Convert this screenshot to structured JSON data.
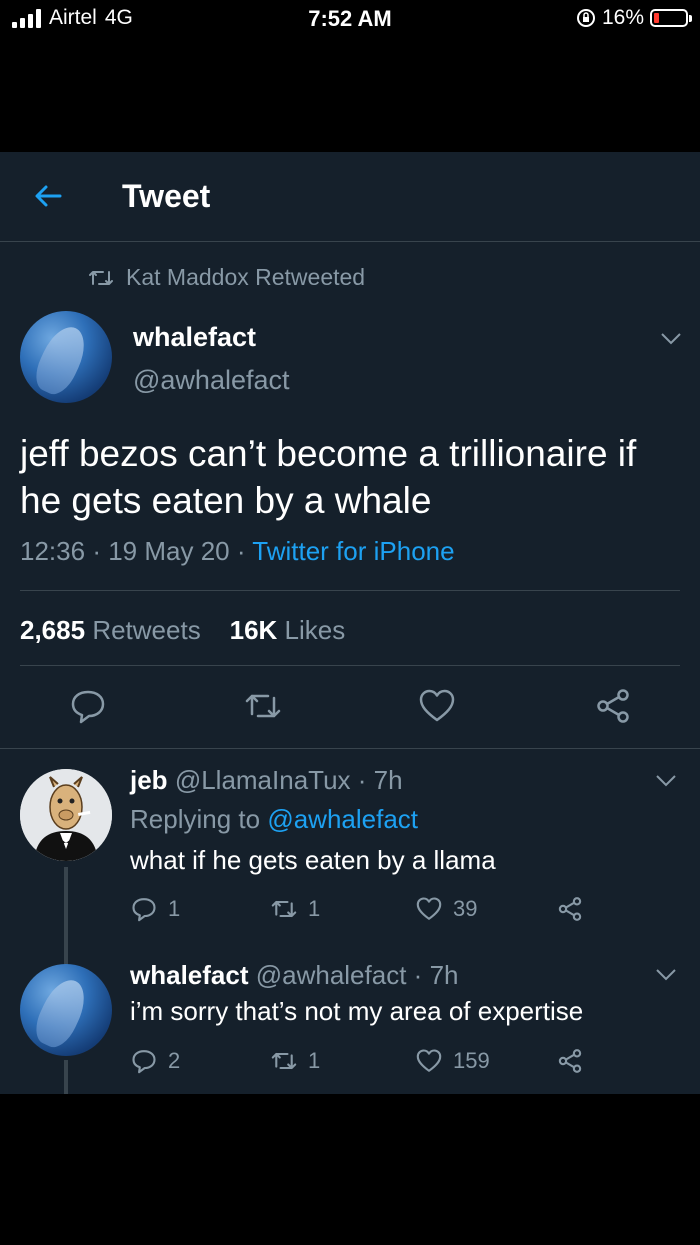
{
  "status_bar": {
    "carrier": "Airtel",
    "network": "4G",
    "time": "7:52 AM",
    "battery": "16%"
  },
  "header": {
    "title": "Tweet"
  },
  "retweet_banner": {
    "text": "Kat Maddox Retweeted"
  },
  "tweet": {
    "author_name": "whalefact",
    "author_handle": "@awhalefact",
    "text": "jeff bezos can’t become a trillionaire if he gets eaten by a whale",
    "time": "12:36",
    "date": "19 May 20",
    "source": "Twitter for iPhone",
    "retweets_count": "2,685",
    "retweets_label": "Retweets",
    "likes_count": "16K",
    "likes_label": "Likes"
  },
  "replies": [
    {
      "name": "jeb",
      "handle": "@LlamaInaTux",
      "age": "7h",
      "replying_prefix": "Replying to",
      "replying_to": "@awhalefact",
      "text": "what if he gets eaten by a llama",
      "reply_count": "1",
      "retweet_count": "1",
      "like_count": "39"
    },
    {
      "name": "whalefact",
      "handle": "@awhalefact",
      "age": "7h",
      "text": "i’m sorry that’s not my area of expertise",
      "reply_count": "2",
      "retweet_count": "1",
      "like_count": "159"
    }
  ],
  "colors": {
    "background": "#15202b",
    "accent": "#1da1f2",
    "muted": "#8899a6",
    "divider": "#38444d"
  }
}
